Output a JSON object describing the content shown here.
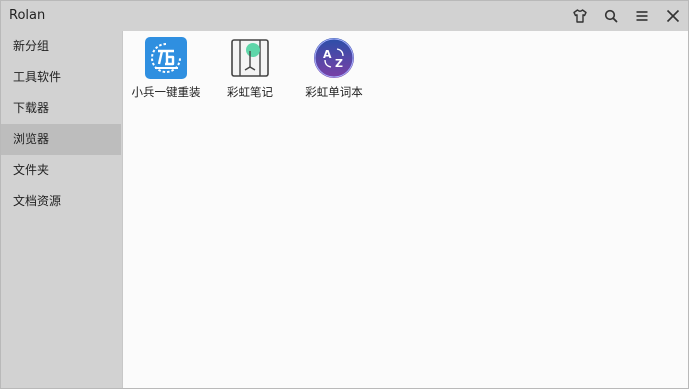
{
  "window": {
    "title": "Rolan"
  },
  "titlebar": {
    "buttons": [
      {
        "name": "skin",
        "icon": "shirt-icon"
      },
      {
        "name": "search",
        "icon": "search-icon"
      },
      {
        "name": "menu",
        "icon": "hamburger-menu-icon"
      },
      {
        "name": "close",
        "icon": "close-icon"
      }
    ]
  },
  "sidebar": {
    "items": [
      {
        "label": "新分组"
      },
      {
        "label": "工具软件"
      },
      {
        "label": "下载器"
      },
      {
        "label": "浏览器",
        "active": true
      },
      {
        "label": "文件夹"
      },
      {
        "label": "文档资源"
      }
    ]
  },
  "apps": [
    {
      "label": "小兵一键重装",
      "icon": "reinstall-app-icon"
    },
    {
      "label": "彩虹笔记",
      "icon": "notebook-app-icon"
    },
    {
      "label": "彩虹单词本",
      "icon": "az-vocabulary-app-icon"
    }
  ],
  "colors": {
    "accent_blue": "#2f8fe0",
    "note_green": "#5fd6a9",
    "vocab_purple": "#7b3fa6"
  }
}
